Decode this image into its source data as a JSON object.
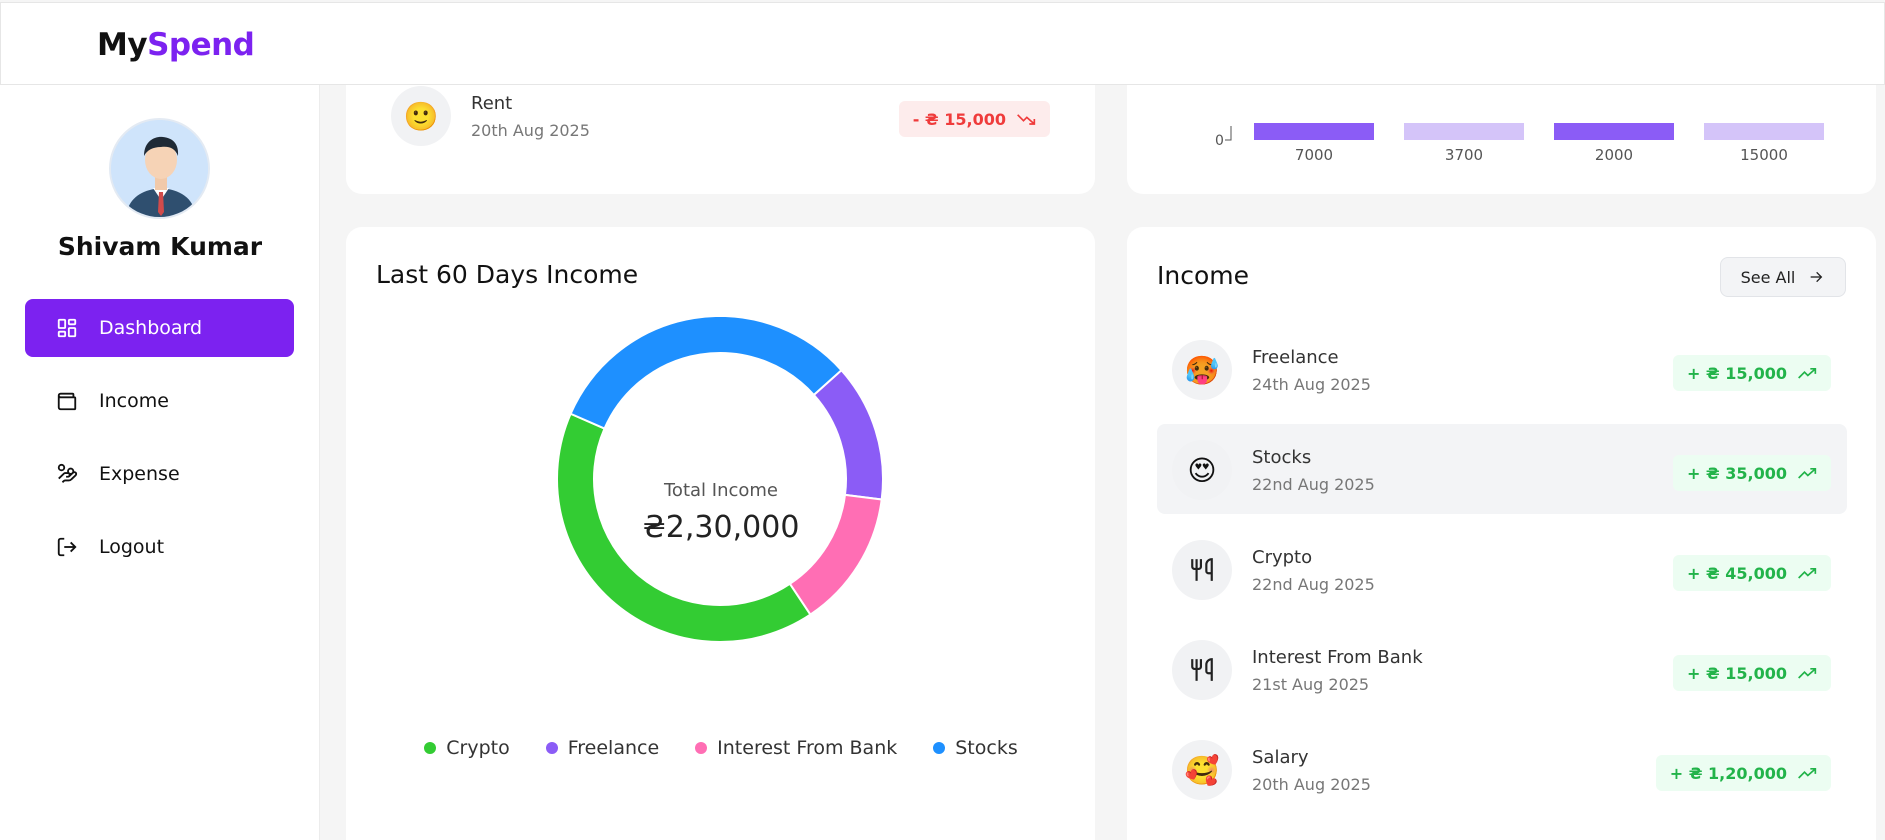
{
  "app": {
    "logo_part1": "My",
    "logo_part2": "Spend",
    "brand_color": "#7c22f0"
  },
  "user": {
    "name": "Shivam Kumar"
  },
  "sidebar": {
    "items": [
      {
        "label": "Dashboard",
        "icon": "dashboard-grid-icon",
        "active": true
      },
      {
        "label": "Income",
        "icon": "wallet-icon",
        "active": false
      },
      {
        "label": "Expense",
        "icon": "hand-coins-icon",
        "active": false
      },
      {
        "label": "Logout",
        "icon": "logout-icon",
        "active": false
      }
    ]
  },
  "top_expense_card": {
    "transaction": {
      "name": "Rent",
      "date": "20th Aug 2025",
      "amount": "- ₴ 15,000",
      "emoji": "🙂",
      "trend": "down"
    }
  },
  "top_bar_card": {
    "chart_data": {
      "type": "bar",
      "categories": [
        "7000",
        "3700",
        "2000",
        "15000"
      ],
      "values": [
        7000,
        3700,
        2000,
        15000
      ],
      "bar_colors": [
        "#8b5cf6",
        "#d4c4f9",
        "#8b5cf6",
        "#d4c4f9"
      ],
      "y_tick_visible": "0"
    }
  },
  "income_chart_card": {
    "title": "Last 60 Days Income",
    "center_label": "Total Income",
    "center_value": "₴2,30,000",
    "chart_data": {
      "type": "pie",
      "donut": true,
      "series": [
        {
          "name": "Crypto",
          "value": 45000,
          "color": "#33cc33"
        },
        {
          "name": "Freelance",
          "value": 15000,
          "color": "#8b5cf6"
        },
        {
          "name": "Interest From Bank",
          "value": 15000,
          "color": "#ff6eb4"
        },
        {
          "name": "Stocks",
          "value": 35000,
          "color": "#1e90ff"
        }
      ],
      "legend": [
        "Crypto",
        "Freelance",
        "Interest From Bank",
        "Stocks"
      ],
      "legend_position": "bottom"
    }
  },
  "income_list_card": {
    "title": "Income",
    "see_all_label": "See All",
    "transactions": [
      {
        "name": "Freelance",
        "date": "24th Aug 2025",
        "amount": "+ ₴ 15,000",
        "emoji": "🥵",
        "icon": "emoji-icon"
      },
      {
        "name": "Stocks",
        "date": "22nd Aug 2025",
        "amount": "+ ₴ 35,000",
        "emoji": "😍",
        "icon": "emoji-icon",
        "highlighted": true
      },
      {
        "name": "Crypto",
        "date": "22nd Aug 2025",
        "amount": "+ ₴ 45,000",
        "icon": "utensils-icon"
      },
      {
        "name": "Interest From Bank",
        "date": "21st Aug 2025",
        "amount": "+ ₴ 15,000",
        "icon": "utensils-icon"
      },
      {
        "name": "Salary",
        "date": "20th Aug 2025",
        "amount": "+ ₴ 1,20,000",
        "emoji": "🥰",
        "icon": "emoji-icon"
      }
    ]
  }
}
